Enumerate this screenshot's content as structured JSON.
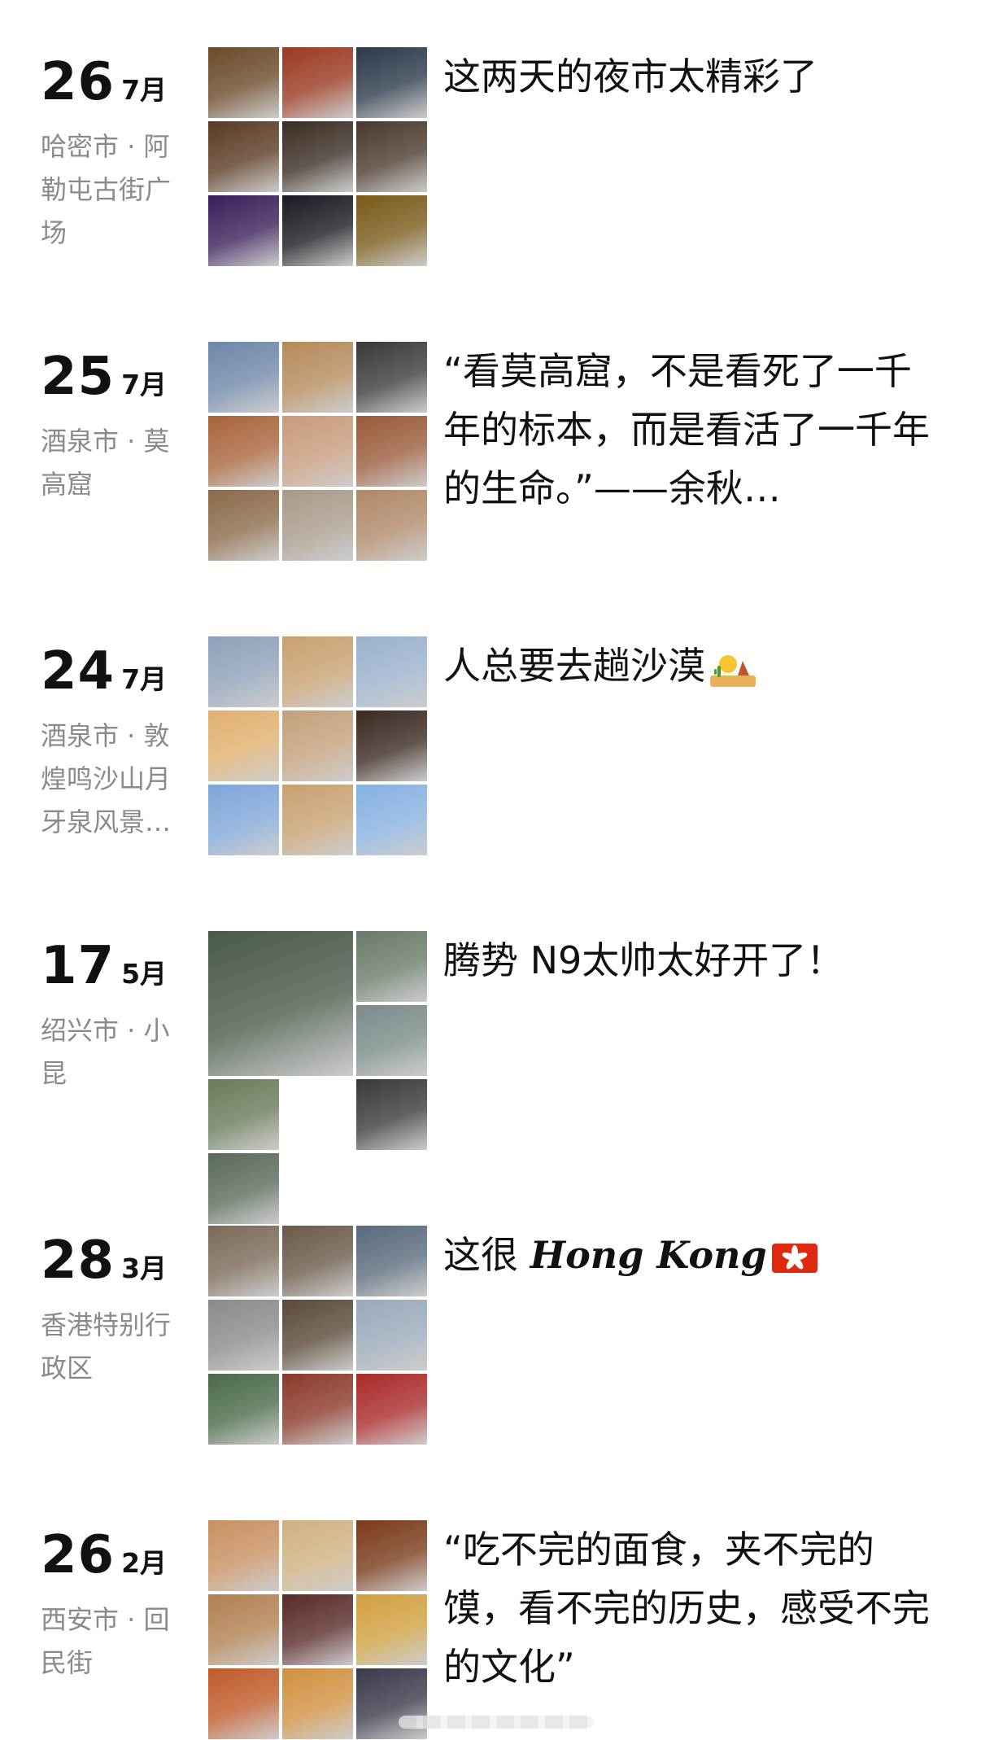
{
  "posts": [
    {
      "day": "26",
      "month": "7月",
      "location": "哈密市 · 阿勒屯古街广场",
      "caption": "这两天的夜市太精彩了",
      "photos": [
        "#6b4a2a",
        "#9a3a22",
        "#2d3a4a",
        "#5a3b24",
        "#3b2e24",
        "#4a3a2e",
        "#3a1f5a",
        "#1a1a22",
        "#7a5a1a"
      ]
    },
    {
      "day": "25",
      "month": "7月",
      "location": "酒泉市 · 莫高窟",
      "caption": "“看莫高窟，不是看死了一千年的标本，而是看活了一千年的生命。”——余秋…",
      "photos": [
        "#6f86a8",
        "#b58a5a",
        "#3a3a3a",
        "#a8643a",
        "#c89a7a",
        "#9a5a3a",
        "#8a6a4a",
        "#a79a8a",
        "#b08868"
      ]
    },
    {
      "day": "24",
      "month": "7月",
      "location": "酒泉市 · 敦煌鸣沙山月牙泉风景…",
      "caption": "人总要去趟沙漠",
      "photos": [
        "#8ea0b8",
        "#c8a06e",
        "#9ab0cc",
        "#e0b070",
        "#c4a07a",
        "#3a2a22",
        "#7ea6d8",
        "#c8a070",
        "#86b0e0"
      ]
    },
    {
      "day": "17",
      "month": "5月",
      "location": "绍兴市 · 小昆",
      "caption": "腾势 N9太帅太好开了！",
      "photos": [
        "#4a5a4a",
        "#6a7a6a",
        "#7a8a8a",
        "#6a7a5a",
        "#3a3a3a",
        "#5a6a5a"
      ]
    },
    {
      "day": "28",
      "month": "3月",
      "location": "香港特别行政区",
      "caption_prefix": "这很 ",
      "caption_emphasis": "Hong Kong",
      "photos": [
        "#7a6a5a",
        "#6a5a4a",
        "#5a6a7a",
        "#8a8a8a",
        "#5a4a3a",
        "#9aa8b8",
        "#4a6a4a",
        "#8a3a2a",
        "#aa2a2a"
      ]
    },
    {
      "day": "26",
      "month": "2月",
      "location": "西安市 · 回民街",
      "caption": "“吃不完的面食，夹不完的馍，看不完的历史，感受不完的文化”",
      "photos": [
        "#c89060",
        "#d0b080",
        "#7a3a1a",
        "#b08050",
        "#5a2a2a",
        "#d0a040",
        "#c05a2a",
        "#d09040",
        "#3a3a4a"
      ]
    }
  ]
}
